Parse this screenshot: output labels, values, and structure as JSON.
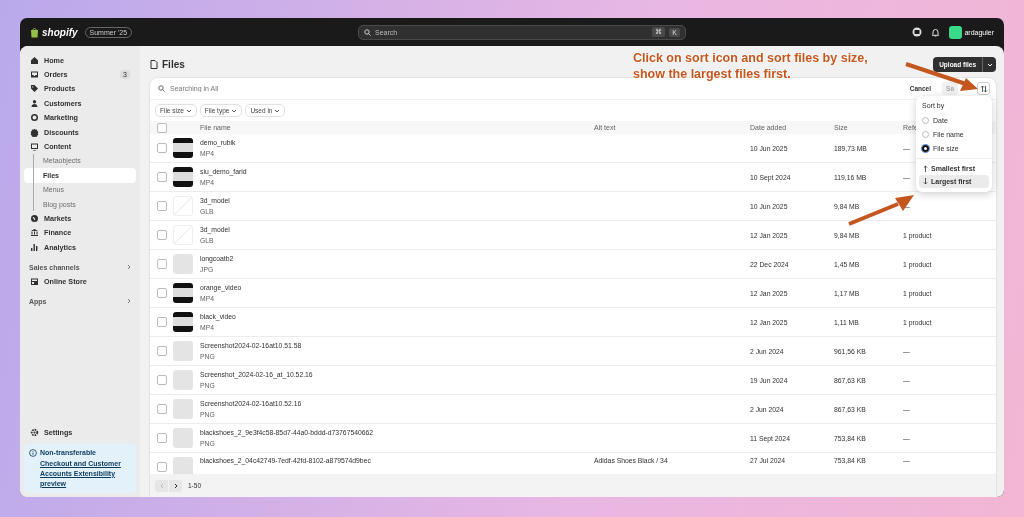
{
  "topbar": {
    "brand": "shopify",
    "edition": "Summer '25",
    "search": {
      "placeholder": "Search",
      "keys": [
        "⌘",
        "K"
      ]
    },
    "user": "ardaguler"
  },
  "sidebar": {
    "items": [
      {
        "label": "Home",
        "selected": false
      },
      {
        "label": "Orders",
        "badge": "3",
        "selected": false
      },
      {
        "label": "Products",
        "selected": false
      },
      {
        "label": "Customers",
        "selected": false
      },
      {
        "label": "Marketing",
        "selected": false
      },
      {
        "label": "Discounts",
        "selected": false
      },
      {
        "label": "Content",
        "selected": false,
        "children": [
          {
            "label": "Metaobjects",
            "selected": false
          },
          {
            "label": "Files",
            "selected": true
          },
          {
            "label": "Menus",
            "selected": false
          },
          {
            "label": "Blog posts",
            "selected": false
          }
        ]
      },
      {
        "label": "Markets",
        "selected": false
      },
      {
        "label": "Finance",
        "selected": false
      },
      {
        "label": "Analytics",
        "selected": false
      }
    ],
    "sections": [
      {
        "label": "Sales channels",
        "items": [
          {
            "label": "Online Store",
            "selected": false
          }
        ]
      },
      {
        "label": "Apps"
      }
    ],
    "settings": "Settings",
    "notice": {
      "title": "Non-transferable",
      "link": "Checkout and Customer Accounts Extensibility preview"
    }
  },
  "page": {
    "title": "Files",
    "upload": "Upload files"
  },
  "card": {
    "search_placeholder": "Searching in All",
    "cancel": "Cancel",
    "save": "Sa",
    "filters": [
      "File size",
      "File type",
      "Used in"
    ],
    "select_all": {
      "checked": false
    },
    "columns": [
      "File name",
      "Alt text",
      "Date added",
      "Size",
      "Refe"
    ],
    "rows": [
      {
        "name": "demo_rubik",
        "type": "MP4",
        "kind": "video",
        "date": "10 Jun 2025",
        "size": "189,73 MB",
        "refs": "—",
        "checked": false
      },
      {
        "name": "siu_demo_farid",
        "type": "MP4",
        "kind": "video",
        "date": "10 Sept 2024",
        "size": "119,16 MB",
        "refs": "—",
        "checked": false
      },
      {
        "name": "3d_model",
        "type": "GLB",
        "kind": "model",
        "date": "10 Jun 2025",
        "size": "9,84 MB",
        "refs": "—",
        "checked": false
      },
      {
        "name": "3d_model",
        "type": "GLB",
        "kind": "model",
        "date": "12 Jan 2025",
        "size": "9,84 MB",
        "refs": "1 product",
        "checked": false
      },
      {
        "name": "longcoatb2",
        "type": "JPG",
        "kind": "photo",
        "date": "22 Dec 2024",
        "size": "1,45 MB",
        "refs": "1 product",
        "checked": false
      },
      {
        "name": "orange_video",
        "type": "MP4",
        "kind": "video",
        "date": "12 Jan 2025",
        "size": "1,17 MB",
        "refs": "1 product",
        "checked": false
      },
      {
        "name": "black_video",
        "type": "MP4",
        "kind": "video",
        "date": "12 Jan 2025",
        "size": "1,11 MB",
        "refs": "1 product",
        "checked": false
      },
      {
        "name": "Screenshot2024-02-16at10.51.58",
        "type": "PNG",
        "kind": "photo",
        "date": "2 Jun 2024",
        "size": "961,56 KB",
        "refs": "—",
        "checked": false
      },
      {
        "name": "Screenshot_2024-02-16_at_10.52.16",
        "type": "PNG",
        "kind": "photo",
        "date": "19 Jun 2024",
        "size": "867,63 KB",
        "refs": "—",
        "checked": false
      },
      {
        "name": "Screenshot2024-02-16at10.52.16",
        "type": "PNG",
        "kind": "photo",
        "date": "2 Jun 2024",
        "size": "867,63 KB",
        "refs": "—",
        "checked": false
      },
      {
        "name": "blackshoes_2_9e3f4c58-85d7-44a0-bddd-d73767540662",
        "type": "PNG",
        "kind": "photo",
        "date": "11 Sept 2024",
        "size": "753,84 KB",
        "refs": "—",
        "checked": false
      },
      {
        "name": "blackshoes_2_04c42749-7edf-42fd-8102-a879574d9bec",
        "kind": "photo",
        "alt": "Adidas Shoes Black / 34",
        "date": "27 Jul 2024",
        "size": "753,84 KB",
        "refs": "—",
        "checked": false
      }
    ],
    "pagination": {
      "range": "1-50"
    }
  },
  "sort_menu": {
    "heading": "Sort by",
    "fields": [
      {
        "label": "Date",
        "selected": false
      },
      {
        "label": "File name",
        "selected": false
      },
      {
        "label": "File size",
        "selected": true
      }
    ],
    "orders": [
      {
        "label": "Smallest first",
        "selected": false
      },
      {
        "label": "Largest first",
        "selected": true
      }
    ]
  },
  "annotation": {
    "lines": [
      "Click on sort icon and sort files by size,",
      "show the largest files first."
    ]
  }
}
